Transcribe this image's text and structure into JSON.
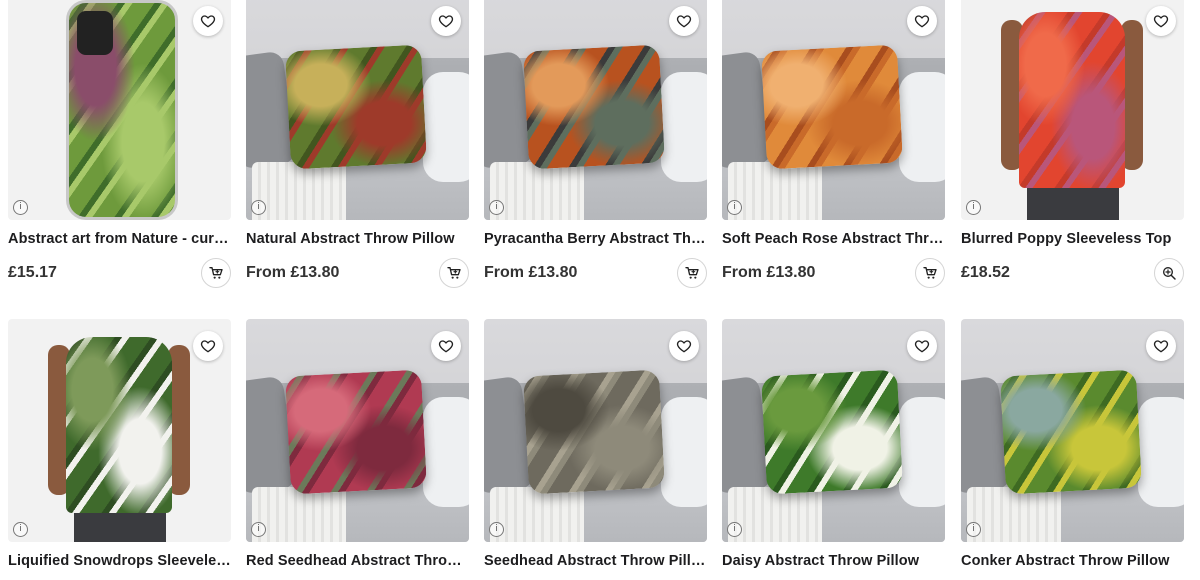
{
  "products": [
    {
      "title": "Abstract art from Nature - curre...",
      "price": "£15.17",
      "action": "add-to-cart",
      "kind": "phone",
      "art": [
        "#6e9a3c",
        "#a8c96a",
        "#8a4d6a",
        "#3f6d2a"
      ]
    },
    {
      "title": "Natural Abstract Throw Pillow",
      "price": "From £13.80",
      "action": "add-to-cart",
      "kind": "pillow",
      "art": [
        "#5f7a2e",
        "#9e3a2a",
        "#c7b05a",
        "#42561f"
      ]
    },
    {
      "title": "Pyracantha Berry Abstract Thro...",
      "price": "From £13.80",
      "action": "add-to-cart",
      "kind": "pillow",
      "art": [
        "#b8521f",
        "#5e6e5e",
        "#e39a5a",
        "#3b3b3b"
      ]
    },
    {
      "title": "Soft Peach Rose Abstract Throw...",
      "price": "From £13.80",
      "action": "add-to-cart",
      "kind": "pillow",
      "art": [
        "#e08a3a",
        "#c96a2a",
        "#f0b070",
        "#a84d1e"
      ]
    },
    {
      "title": "Blurred Poppy Sleeveless Top",
      "price": "£18.52",
      "action": "zoom",
      "kind": "top",
      "art": [
        "#e2452f",
        "#b9567a",
        "#f06a4a",
        "#c43a2a"
      ]
    },
    {
      "title": "Liquified Snowdrops Sleeveless ...",
      "kind": "top",
      "art": [
        "#3f6a2c",
        "#f2f2ee",
        "#7e9a5a",
        "#2e4d22"
      ]
    },
    {
      "title": "Red Seedhead Abstract Throw P...",
      "kind": "pillow",
      "art": [
        "#b03a52",
        "#7e2a3e",
        "#d66a7a",
        "#6b7a5a"
      ]
    },
    {
      "title": "Seedhead Abstract Throw Pillow",
      "kind": "pillow",
      "art": [
        "#6e6a5e",
        "#8e8a7a",
        "#4e4a40",
        "#a8a290"
      ]
    },
    {
      "title": "Daisy Abstract Throw Pillow",
      "kind": "pillow",
      "art": [
        "#3e7a2a",
        "#f0f2e6",
        "#6a9a3e",
        "#2a5a1e"
      ]
    },
    {
      "title": "Conker Abstract Throw Pillow",
      "kind": "pillow",
      "art": [
        "#5a8a2e",
        "#c8c63a",
        "#8aa8a0",
        "#3e6a22"
      ]
    }
  ]
}
